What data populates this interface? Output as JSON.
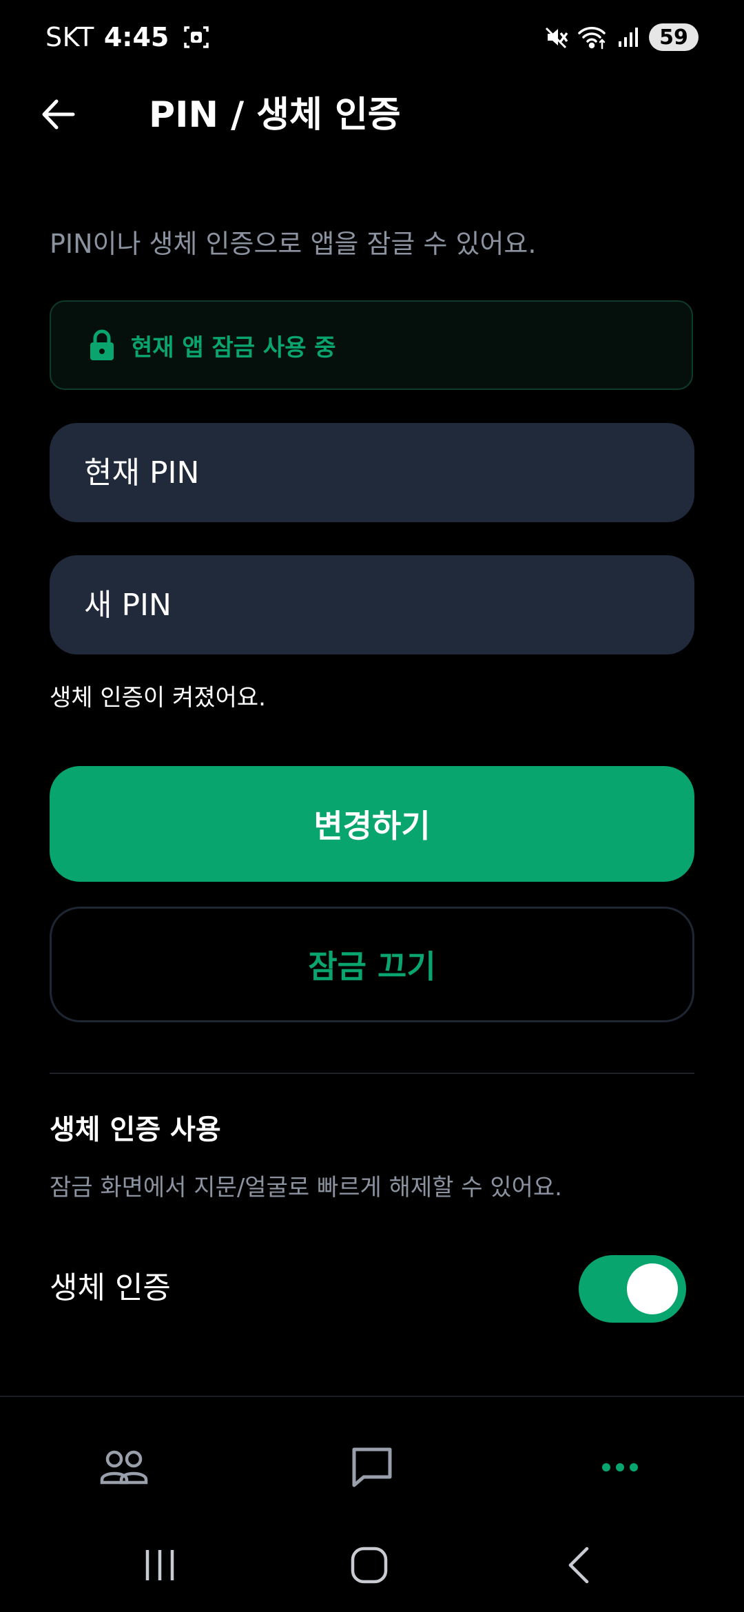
{
  "status_bar": {
    "carrier": "SKT",
    "time": "4:45",
    "battery": "59"
  },
  "header": {
    "title": "PIN / 생체 인증"
  },
  "description": "PIN이나 생체 인증으로 앱을 잠글 수 있어요.",
  "lock_status": {
    "text": "현재 앱 잠금 사용 중",
    "icon": "lock-icon"
  },
  "fields": {
    "current_pin_placeholder": "현재 PIN",
    "new_pin_placeholder": "새 PIN"
  },
  "biometric_status": "생체 인증이 켜졌어요.",
  "buttons": {
    "change": "변경하기",
    "disable_lock": "잠금 끄기"
  },
  "biometric_section": {
    "title": "생체 인증 사용",
    "description": "잠금 화면에서 지문/얼굴로 빠르게 해제할 수 있어요.",
    "toggle_label": "생체 인증",
    "enabled": true
  },
  "colors": {
    "accent": "#08a66e",
    "field_bg": "#212a3b",
    "muted": "#8c93a0"
  },
  "bottom_nav": {
    "items": [
      "friends-icon",
      "chat-icon",
      "more-icon"
    ],
    "active": "more-icon"
  }
}
